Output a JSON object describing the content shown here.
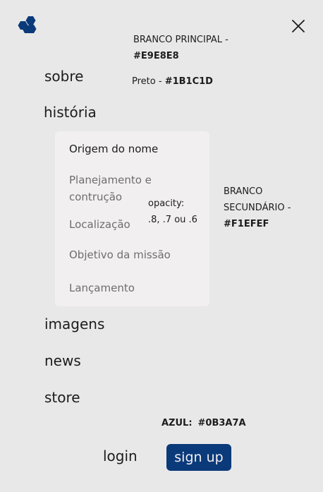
{
  "colors": {
    "background": "#E9E8E8",
    "text": "#1B1C1D",
    "submenu_bg": "#F1EFEF",
    "accent": "#0B3A7A"
  },
  "icons": {
    "logo": "hexagon-cluster-logo",
    "close": "close-icon"
  },
  "nav": {
    "items": [
      {
        "label": "sobre"
      },
      {
        "label": "história"
      },
      {
        "label": "imagens"
      },
      {
        "label": "news"
      },
      {
        "label": "store"
      }
    ],
    "submenu": [
      {
        "label": "Origem do nome"
      },
      {
        "label": "Planejamento e contrução"
      },
      {
        "label": "Localização"
      },
      {
        "label": "Objetivo da missão"
      },
      {
        "label": "Lançamento"
      }
    ]
  },
  "notes": {
    "branco_principal_label": "BRANCO PRINCIPAL -",
    "branco_principal_value": "#E9E8E8",
    "preto_label": "Preto - ",
    "preto_value": "#1B1C1D",
    "opacity_label": "opacity:",
    "opacity_value": ".8, .7 ou .6",
    "branco_sec_label": "BRANCO SECUNDÁRIO - ",
    "branco_sec_value": "#F1EFEF",
    "azul_label": "AZUL:",
    "azul_value": "#0B3A7A"
  },
  "auth": {
    "login_label": "login",
    "signup_label": "sign up"
  }
}
